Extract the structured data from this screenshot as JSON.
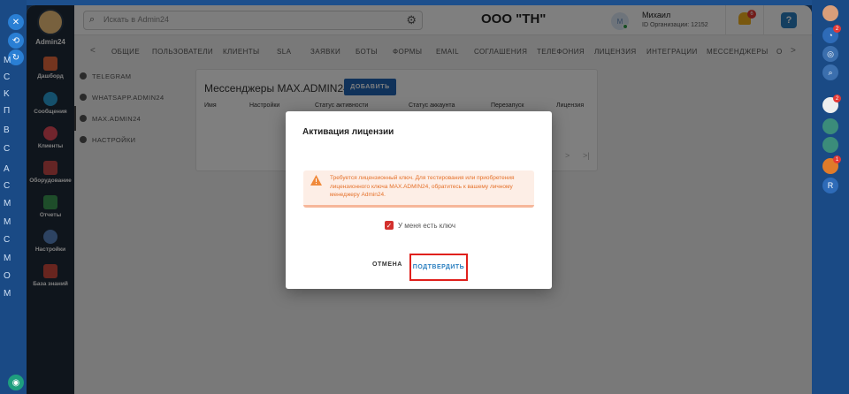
{
  "colors": {
    "outer_background": "#1d4f8c",
    "sidebar_background": "#1f2a38",
    "primary_button": "#2065b5",
    "warning_text": "#e5712a",
    "warning_background": "#fdeee6",
    "highlight_border": "#e0201c",
    "checkbox": "#d3312d"
  },
  "outer_left": {
    "letters": [
      "F",
      "M",
      "C",
      "K",
      "П",
      "B",
      "C",
      "A",
      "C",
      "M",
      "M",
      "C",
      "M",
      "O",
      "M"
    ]
  },
  "outer_right": {
    "badges": [
      "2",
      "2",
      "1"
    ]
  },
  "sidebar": {
    "brand_name": "Admin24",
    "items": [
      {
        "label": "Дашборд",
        "icon": "dashboard-icon"
      },
      {
        "label": "Сообщения",
        "icon": "messages-icon"
      },
      {
        "label": "Клиенты",
        "icon": "clients-icon"
      },
      {
        "label": "Оборудование",
        "icon": "equipment-icon"
      },
      {
        "label": "Отчеты",
        "icon": "reports-icon"
      },
      {
        "label": "Настройки",
        "icon": "settings-icon"
      },
      {
        "label": "База знаний",
        "icon": "knowledge-base-icon"
      }
    ]
  },
  "header": {
    "search_placeholder": "Искать в Admin24",
    "org_title": "ООО \"ТН\"",
    "user_initial": "М",
    "user_name": "Михаил",
    "org_id_label": "ID Организации: 12152",
    "notification_count": "6",
    "help_label": "?"
  },
  "tabs": {
    "prev": "<",
    "next": ">",
    "items": [
      "ОБЩИЕ",
      "ПОЛЬЗОВАТЕЛИ",
      "КЛИЕНТЫ",
      "SLA",
      "ЗАЯВКИ",
      "БОТЫ",
      "ФОРМЫ",
      "EMAIL",
      "СОГЛАШЕНИЯ",
      "ТЕЛЕФОНИЯ",
      "ЛИЦЕНЗИЯ",
      "ИНТЕГРАЦИИ",
      "МЕССЕНДЖЕРЫ",
      "О"
    ]
  },
  "submenu": {
    "items": [
      "TELEGRAM",
      "WHATSAPP.ADMIN24",
      "MAX.ADMIN24",
      "НАСТРОЙКИ"
    ],
    "active": "MAX.ADMIN24"
  },
  "panel": {
    "title": "Мессенджеры MAX.ADMIN24",
    "add_button": "ДОБАВИТЬ",
    "columns": [
      "Имя",
      "Настройки",
      "Статус активности",
      "Статус аккаунта",
      "Перезапуск",
      "Лицензия"
    ],
    "pager_next": ">",
    "pager_last": ">|"
  },
  "dialog": {
    "title": "Активация лицензии",
    "warning": "Требуется лицензионный ключ. Для тестирования или приобретения лицензионного ключа MAX.ADMIN24, обратитесь к вашему личному менеджеру Admin24.",
    "checkbox_label": "У меня есть ключ",
    "checkbox_checked": true,
    "cancel": "ОТМЕНА",
    "confirm": "ПОДТВЕРДИТЬ"
  }
}
